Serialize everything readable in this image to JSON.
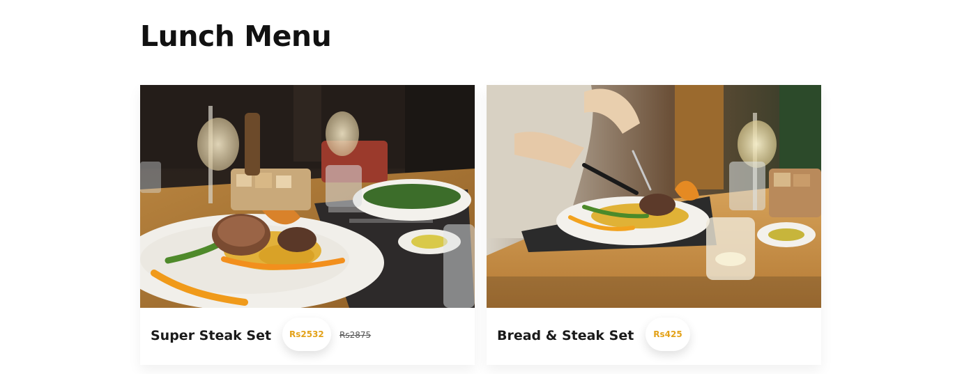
{
  "page": {
    "title": "Lunch Menu"
  },
  "menu_items": [
    {
      "name": "Super Steak Set",
      "price": "Rs2532",
      "old_price": "Rs2875",
      "image_icon": "steak-plate-photo"
    },
    {
      "name": "Bread & Steak Set",
      "price": "Rs425",
      "image_icon": "steak-plate-photo"
    }
  ],
  "colors": {
    "price": "#e3a21a",
    "title": "#111111",
    "background": "#ffffff"
  }
}
